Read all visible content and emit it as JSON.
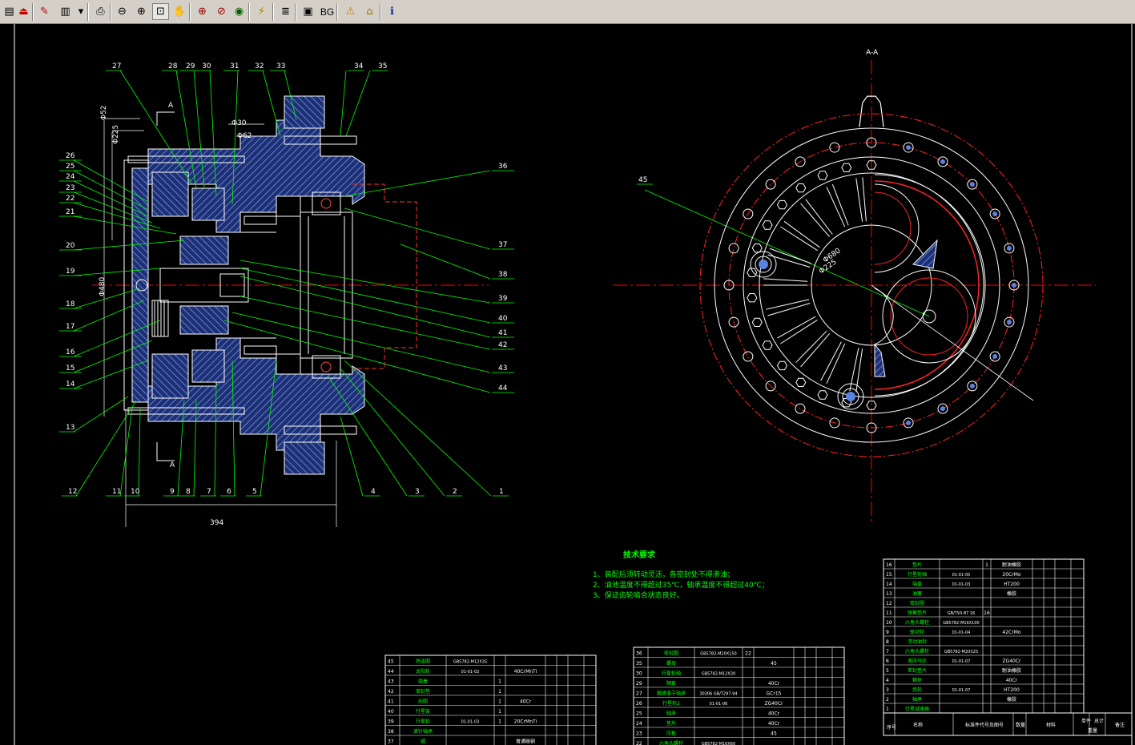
{
  "toolbar": {
    "buttons": [
      {
        "icon": "save-icon",
        "glyph": "▤"
      },
      {
        "icon": "exit-icon",
        "glyph": "⏏"
      },
      {
        "icon": "measure-icon",
        "glyph": "✎"
      },
      {
        "icon": "layer-select-icon",
        "glyph": "▥"
      },
      {
        "icon": "dropdown-icon",
        "glyph": "▾"
      },
      {
        "icon": "print-icon",
        "glyph": "⎙"
      },
      {
        "icon": "zoom-out-icon",
        "glyph": "⊖"
      },
      {
        "icon": "zoom-in-icon",
        "glyph": "⊕"
      },
      {
        "icon": "zoom-window-icon",
        "glyph": "⊡"
      },
      {
        "icon": "pan-icon",
        "glyph": "✋"
      },
      {
        "icon": "zoom-all-icon",
        "glyph": "⊕"
      },
      {
        "icon": "zoom-previous-icon",
        "glyph": "⊘"
      },
      {
        "icon": "view-3d-icon",
        "glyph": "◉"
      },
      {
        "icon": "highlight-icon",
        "glyph": "⚡"
      },
      {
        "icon": "layers-icon",
        "glyph": "≣"
      },
      {
        "icon": "screen-icon",
        "glyph": "▣"
      },
      {
        "icon": "background-icon",
        "glyph": "BG"
      },
      {
        "icon": "warning-icon",
        "glyph": "⚠"
      },
      {
        "icon": "home-icon",
        "glyph": "⌂"
      },
      {
        "icon": "info-icon",
        "glyph": "ℹ"
      }
    ]
  },
  "drawing": {
    "section_labels": [
      "A",
      "A",
      "A-A"
    ],
    "dims": [
      "Φ52",
      "Φ225",
      "Φ30",
      "Φ62",
      "Φ480",
      "394",
      "Φ680",
      "Φ225"
    ],
    "callouts": [
      "27",
      "28",
      "29",
      "30",
      "31",
      "32",
      "33",
      "34",
      "35",
      "26",
      "25",
      "24",
      "23",
      "22",
      "21",
      "20",
      "19",
      "18",
      "17",
      "16",
      "15",
      "14",
      "13",
      "36",
      "37",
      "38",
      "39",
      "40",
      "41",
      "42",
      "43",
      "44",
      "12",
      "11",
      "10",
      "9",
      "8",
      "7",
      "6",
      "5",
      "4",
      "3",
      "2",
      "1",
      "45"
    ],
    "notes_title": "技术要求",
    "notes": [
      "1、装配后须转动灵活，各密封处不得渗油；",
      "2、油池温度不得超过35℃，轴承温度不得超过40℃；",
      "3、保证齿轮啮合状态良好。"
    ],
    "bom_left": [
      {
        "no": "45",
        "name": "挡油圈",
        "std": "GB5782-M12X35",
        "qty": "",
        "mat": ""
      },
      {
        "no": "44",
        "name": "太阳轮",
        "std": "01-01-02",
        "qty": "",
        "mat": "40CrMnTi"
      },
      {
        "no": "43",
        "name": "端盖",
        "std": "",
        "qty": "1",
        "mat": ""
      },
      {
        "no": "42",
        "name": "密封垫",
        "std": "",
        "qty": "1",
        "mat": ""
      },
      {
        "no": "41",
        "name": "齿圈",
        "std": "",
        "qty": "1",
        "mat": "40Cr"
      },
      {
        "no": "40",
        "name": "行星架",
        "std": "",
        "qty": "1",
        "mat": ""
      },
      {
        "no": "39",
        "name": "行星轮",
        "std": "01-01-03",
        "qty": "1",
        "mat": "20CrMnTi"
      },
      {
        "no": "38",
        "name": "滚针轴承",
        "std": "",
        "qty": "",
        "mat": ""
      },
      {
        "no": "37",
        "name": "键",
        "std": "",
        "qty": "",
        "mat": "普通碳钢"
      }
    ],
    "bom_mid": [
      {
        "no": "36",
        "name": "密封圈",
        "std": "GB5782-M20X150",
        "qty": "22",
        "mat": ""
      },
      {
        "no": "35",
        "name": "螺母",
        "std": "",
        "qty": "",
        "mat": "45"
      },
      {
        "no": "30",
        "name": "行星轮轴",
        "std": "GB5782-M12X30",
        "qty": "",
        "mat": ""
      },
      {
        "no": "29",
        "name": "隔套",
        "std": "",
        "qty": "",
        "mat": "40Cr"
      },
      {
        "no": "27",
        "name": "圆锥滚子轴承",
        "std": "30306 GB/T297-94",
        "qty": "",
        "mat": "GCr15"
      },
      {
        "no": "26",
        "name": "行星轮2",
        "std": "01-01-06",
        "qty": "",
        "mat": "ZG40Cr"
      },
      {
        "no": "25",
        "name": "轴承",
        "std": "",
        "qty": "",
        "mat": "40Cr"
      },
      {
        "no": "24",
        "name": "垫片",
        "std": "",
        "qty": "",
        "mat": "40Cr"
      },
      {
        "no": "23",
        "name": "压板",
        "std": "",
        "qty": "",
        "mat": "45"
      },
      {
        "no": "22",
        "name": "六角头螺栓",
        "std": "GB5782-M16X60",
        "qty": "",
        "mat": ""
      }
    ],
    "bom_right": [
      {
        "no": "16",
        "name": "垫片",
        "std": "",
        "qty": "1",
        "mat": "耐油橡胶"
      },
      {
        "no": "15",
        "name": "行星轮轴",
        "std": "01-01-05",
        "qty": "",
        "mat": "20CrMo"
      },
      {
        "no": "14",
        "name": "端盖",
        "std": "01-01-03",
        "qty": "",
        "mat": "HT200"
      },
      {
        "no": "13",
        "name": "油塞",
        "std": "",
        "qty": "",
        "mat": "橡胶"
      },
      {
        "no": "12",
        "name": "密封圈",
        "std": "",
        "qty": "",
        "mat": ""
      },
      {
        "no": "11",
        "name": "弹簧垫片",
        "std": "GB/T93-87 16",
        "qty": "16",
        "mat": ""
      },
      {
        "no": "10",
        "name": "六角头螺栓",
        "std": "GB5782-M16X100",
        "qty": "",
        "mat": ""
      },
      {
        "no": "9",
        "name": "驱动轮",
        "std": "01-01-04",
        "qty": "",
        "mat": "42CrMo"
      },
      {
        "no": "8",
        "name": "浮动油封",
        "std": "",
        "qty": "",
        "mat": ""
      },
      {
        "no": "7",
        "name": "六角头螺栓",
        "std": "GB5782-M20X25",
        "qty": "",
        "mat": ""
      },
      {
        "no": "6",
        "name": "液压马达",
        "std": "01-01-07",
        "qty": "",
        "mat": "ZG40Cr"
      },
      {
        "no": "5",
        "name": "密封垫片",
        "std": "",
        "qty": "",
        "mat": "耐油橡胶"
      },
      {
        "no": "4",
        "name": "箱体",
        "std": "",
        "qty": "",
        "mat": "40Cr"
      },
      {
        "no": "3",
        "name": "齿轮",
        "std": "01-01-07",
        "qty": "",
        "mat": "HT200"
      },
      {
        "no": "2",
        "name": "轴承",
        "std": "",
        "qty": "",
        "mat": "橡胶"
      },
      {
        "no": "1",
        "name": "行星减速器",
        "std": "",
        "qty": "",
        "mat": ""
      }
    ],
    "bom_header": [
      "序号",
      "名称",
      "标准件代号及图号",
      "数量",
      "材料",
      "单件",
      "总计",
      "备注",
      "重量"
    ]
  },
  "colors": {
    "background": "#000000",
    "toolbar": "#d4d0c8",
    "line": "#ffffff",
    "leader": "#00ff00",
    "center": "#ff0000",
    "hatch": "#3c6ccf",
    "dim": "#00ffff",
    "note": "#00ff00"
  }
}
